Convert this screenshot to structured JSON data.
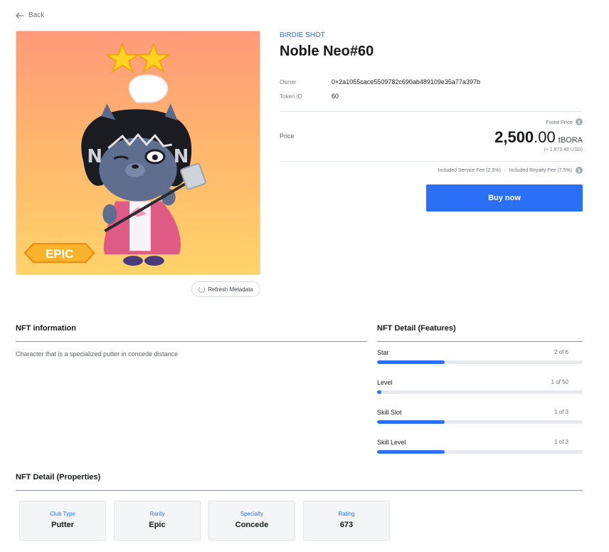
{
  "nav": {
    "back_label": "Back"
  },
  "item": {
    "collection": "BIRDIE SHOT",
    "title": "Noble Neo#60",
    "badge_text": "EPIC",
    "star_count": 2
  },
  "meta": {
    "owner_label": "Owner",
    "owner_value": "0×2a1055cace5509782c690ab489109e35a77a397b",
    "token_label": "Token ID",
    "token_value": "60"
  },
  "price": {
    "fixed_label": "Fixed Price",
    "label": "Price",
    "integer": "2,500",
    "decimal": ".00",
    "unit": "tBORA",
    "usd": "(≈ 1,879.48 USD)",
    "service_fee": "Included Service Fee (2.5%)",
    "separator": "|",
    "royalty_fee": "Included Royalty Fee (7.5%)"
  },
  "actions": {
    "buy_label": "Buy now",
    "refresh_label": "Refresh Metadata"
  },
  "info": {
    "title": "NFT information",
    "description": "Character that is a specialized putter in concede distance"
  },
  "features": {
    "title": "NFT Detail (Features)",
    "items": [
      {
        "label": "Star",
        "count_text": "2 of 6",
        "progress": 0.33
      },
      {
        "label": "Level",
        "count_text": "1 of 50",
        "progress": 0.02
      },
      {
        "label": "Skill Slot",
        "count_text": "1 of 3",
        "progress": 0.33
      },
      {
        "label": "Skill Level",
        "count_text": "1 of 3",
        "progress": 0.33
      }
    ]
  },
  "properties": {
    "title": "NFT Detail (Properties)",
    "items": [
      {
        "label": "Club Type",
        "value": "Putter"
      },
      {
        "label": "Rarity",
        "value": "Epic"
      },
      {
        "label": "Specialty",
        "value": "Concede"
      },
      {
        "label": "Rating",
        "value": "673"
      }
    ]
  },
  "colors": {
    "accent": "#2a6ff5",
    "track": "#e8e9ec",
    "badge": "#f0a21a"
  },
  "icons": {
    "back": "arrow-left-icon",
    "info": "info-icon",
    "refresh": "refresh-icon",
    "star": "star-icon"
  }
}
